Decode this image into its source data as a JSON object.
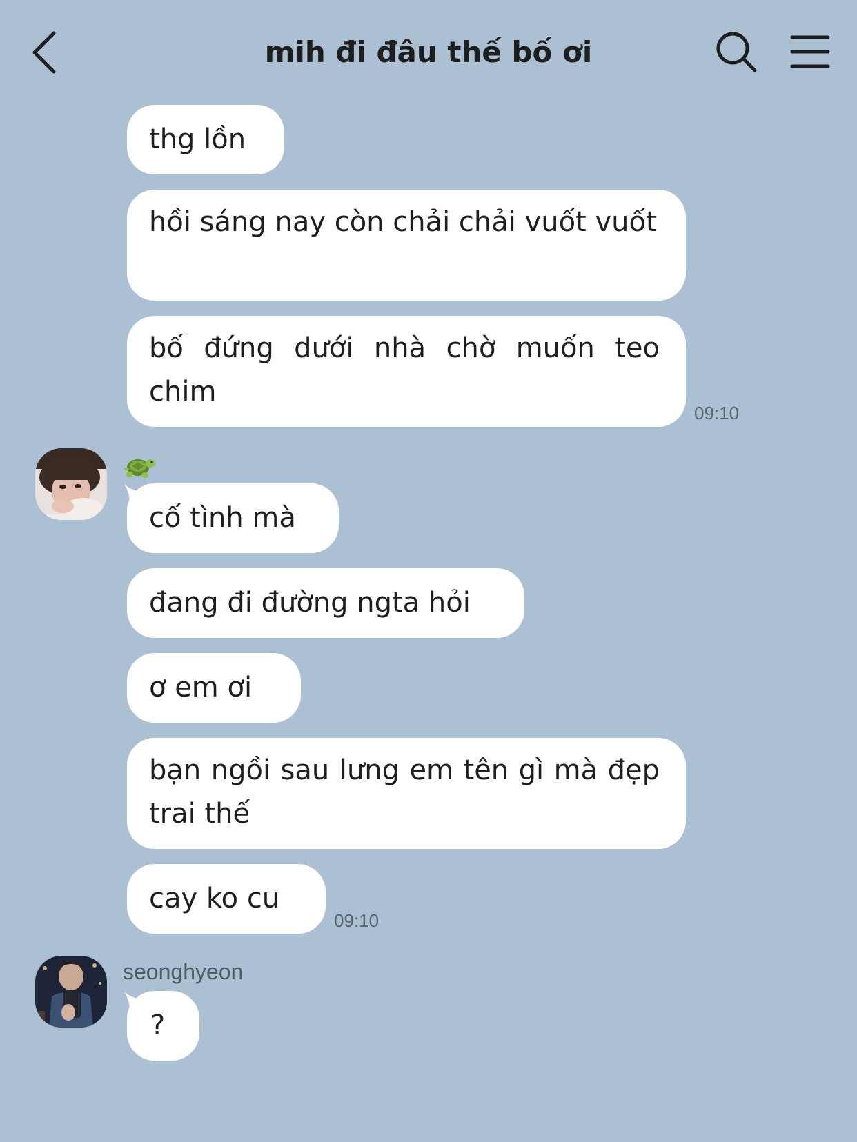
{
  "header": {
    "title": "mih đi đâu thế bố ơi",
    "back_icon": "chevron-left-icon",
    "search_icon": "search-icon",
    "menu_icon": "menu-icon"
  },
  "colors": {
    "background": "#abc1d3",
    "bubble": "#ffffff",
    "text": "#1e1e1e",
    "timestamp": "#54636f"
  },
  "groups": [
    {
      "sender_name": "",
      "messages": [
        "thg lồn",
        "hồi sáng nay còn chải chải vuốt vuốt",
        "bố đứng dưới nhà chờ muốn teo chim"
      ],
      "time": "09:10"
    },
    {
      "sender_name": "🐢",
      "messages": [
        "cố tình mà",
        "đang đi đường ngta hỏi",
        "ơ em ơi",
        "bạn ngồi sau lưng em tên gì mà đẹp trai thế",
        "cay ko cu"
      ],
      "time": "09:10"
    },
    {
      "sender_name": "seonghyeon",
      "messages": [
        "?"
      ],
      "time": ""
    }
  ]
}
